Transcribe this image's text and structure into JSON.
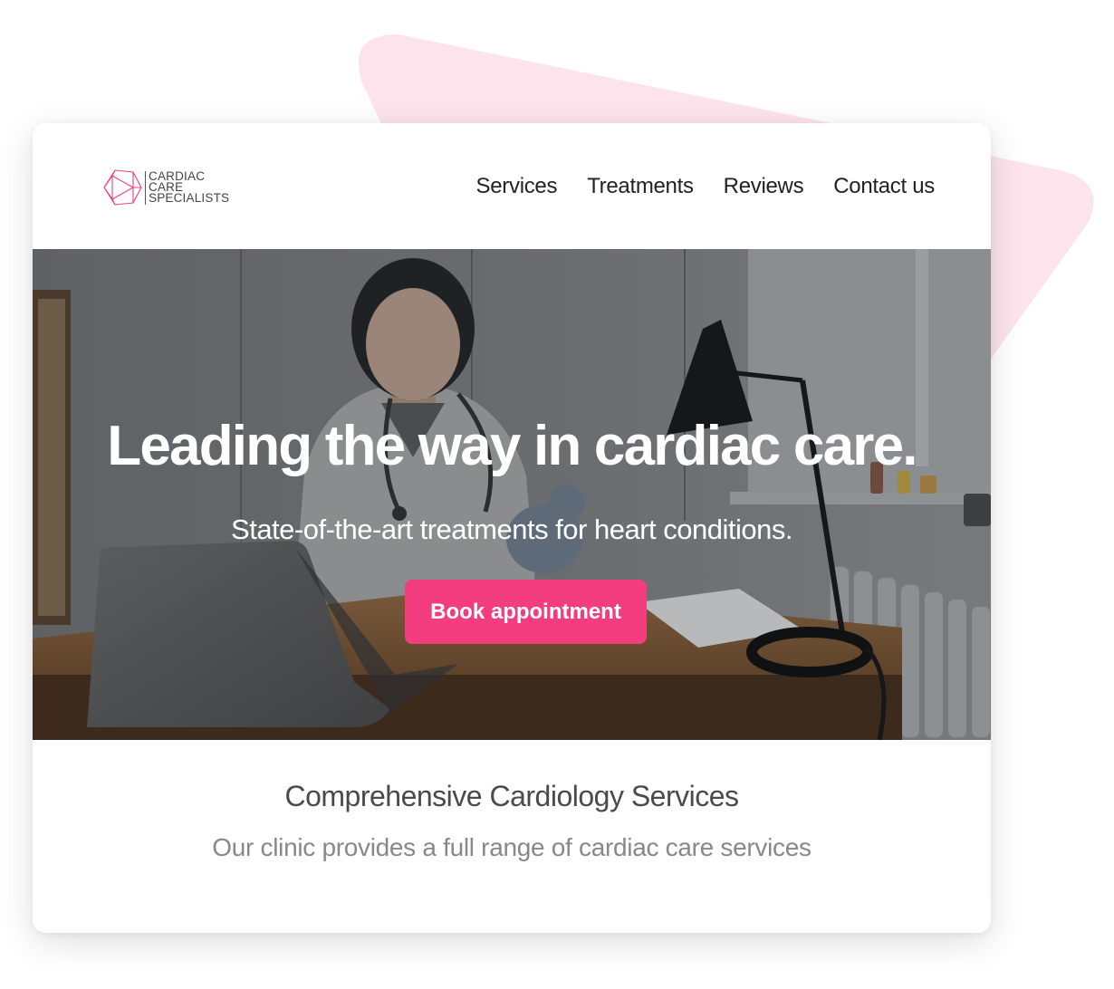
{
  "brand": {
    "logo_lines": [
      "CARDIAC",
      "CARE",
      "SPECIALISTS"
    ],
    "accent_color": "#f33d7f",
    "shape_color": "#fde4ec"
  },
  "nav": {
    "items": [
      {
        "label": "Services"
      },
      {
        "label": "Treatments"
      },
      {
        "label": "Reviews"
      },
      {
        "label": "Contact us"
      }
    ]
  },
  "hero": {
    "title": "Leading the way in cardiac care.",
    "subtitle": "State-of-the-art treatments for heart conditions.",
    "cta_label": "Book appointment",
    "photo_alt": "hero-photo-doctor-at-desk"
  },
  "services": {
    "title": "Comprehensive Cardiology Services",
    "description": "Our clinic provides a full range of cardiac care services"
  }
}
